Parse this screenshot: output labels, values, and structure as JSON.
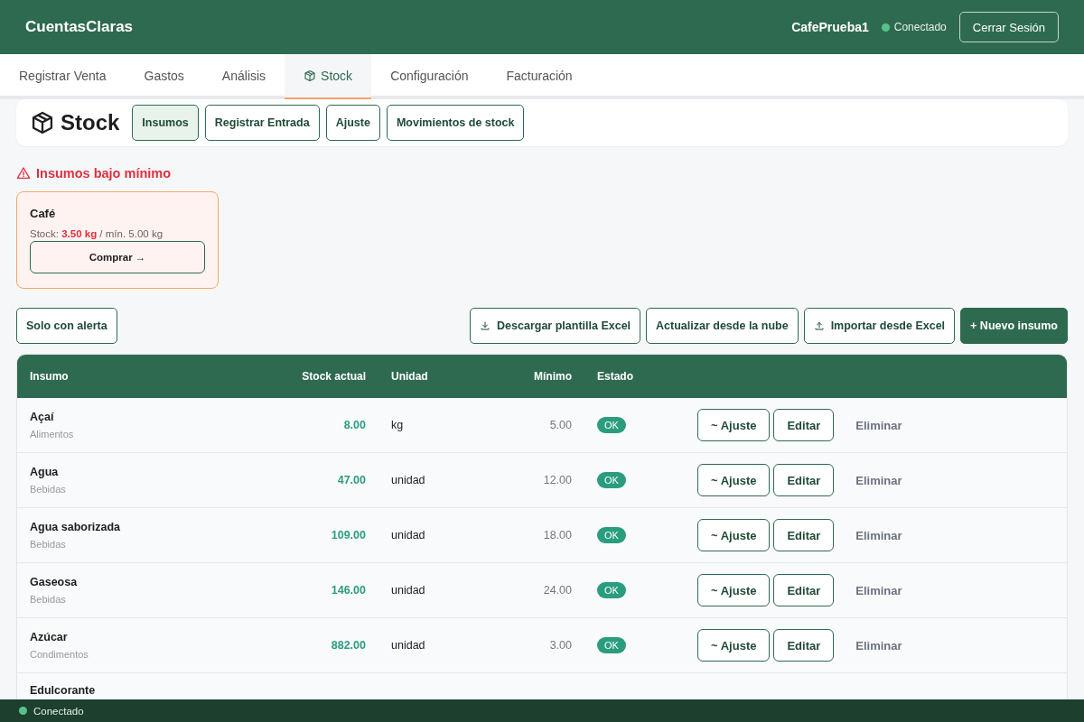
{
  "header": {
    "brand": "CuentasClaras",
    "user": "CafePrueba1",
    "connection": {
      "label": "Conectado",
      "online": true
    },
    "logout": "Cerrar Sesión"
  },
  "tabs": [
    {
      "label": "Registrar Venta",
      "selected": false,
      "kind": "plain"
    },
    {
      "label": "Gastos",
      "selected": false,
      "kind": "plain"
    },
    {
      "label": "Análisis",
      "selected": false,
      "kind": "plain"
    },
    {
      "label": "Stock",
      "selected": true,
      "kind": "iconic"
    },
    {
      "label": "Configuración",
      "selected": false,
      "kind": "plain"
    },
    {
      "label": "Facturación",
      "selected": false,
      "kind": "plain"
    }
  ],
  "section": {
    "title": "Stock",
    "subtabs": [
      {
        "label": "Insumos",
        "selected": true
      },
      {
        "label": "Registrar Entrada",
        "selected": false
      },
      {
        "label": "Ajuste",
        "selected": false
      },
      {
        "label": "Movimientos de stock",
        "selected": false
      }
    ]
  },
  "alerts": {
    "title": "Insumos bajo mínimo",
    "items": [
      {
        "name": "Café",
        "stock_label": "Stock:",
        "stock": "3.50 kg",
        "minimum": "/ mín. 5.00 kg",
        "action": "Comprar →"
      }
    ]
  },
  "toolbar": {
    "filter": {
      "label": "Solo con alerta",
      "selected": false
    },
    "actions": [
      {
        "label": "Descargar plantilla Excel",
        "kind": "download"
      },
      {
        "label": "Actualizar desde la nube",
        "kind": "plain"
      },
      {
        "label": "Importar desde Excel",
        "kind": "upload"
      },
      {
        "label": "+ Nuevo insumo",
        "kind": "primary"
      }
    ]
  },
  "table": {
    "columns": [
      "Insumo",
      "Stock actual",
      "Unidad",
      "Mínimo",
      "Estado"
    ],
    "rows": [
      {
        "name": "Açaí",
        "category": "Alimentos",
        "stock": "8.00",
        "unit": "kg",
        "minimum": "5.00",
        "status": "OK",
        "actions": [
          "~ Ajuste",
          "Editar",
          "Eliminar"
        ]
      },
      {
        "name": "Agua",
        "category": "Bebidas",
        "stock": "47.00",
        "unit": "unidad",
        "minimum": "12.00",
        "status": "OK",
        "actions": [
          "~ Ajuste",
          "Editar",
          "Eliminar"
        ]
      },
      {
        "name": "Agua saborizada",
        "category": "Bebidas",
        "stock": "109.00",
        "unit": "unidad",
        "minimum": "18.00",
        "status": "OK",
        "actions": [
          "~ Ajuste",
          "Editar",
          "Eliminar"
        ]
      },
      {
        "name": "Gaseosa",
        "category": "Bebidas",
        "stock": "146.00",
        "unit": "unidad",
        "minimum": "24.00",
        "status": "OK",
        "actions": [
          "~ Ajuste",
          "Editar",
          "Eliminar"
        ]
      },
      {
        "name": "Azúcar",
        "category": "Condimentos",
        "stock": "882.00",
        "unit": "unidad",
        "minimum": "3.00",
        "status": "OK",
        "actions": [
          "~ Ajuste",
          "Editar",
          "Eliminar"
        ]
      },
      {
        "name": "Edulcorante"
      }
    ]
  },
  "status_bar": {
    "label": "Conectado",
    "online": true
  }
}
